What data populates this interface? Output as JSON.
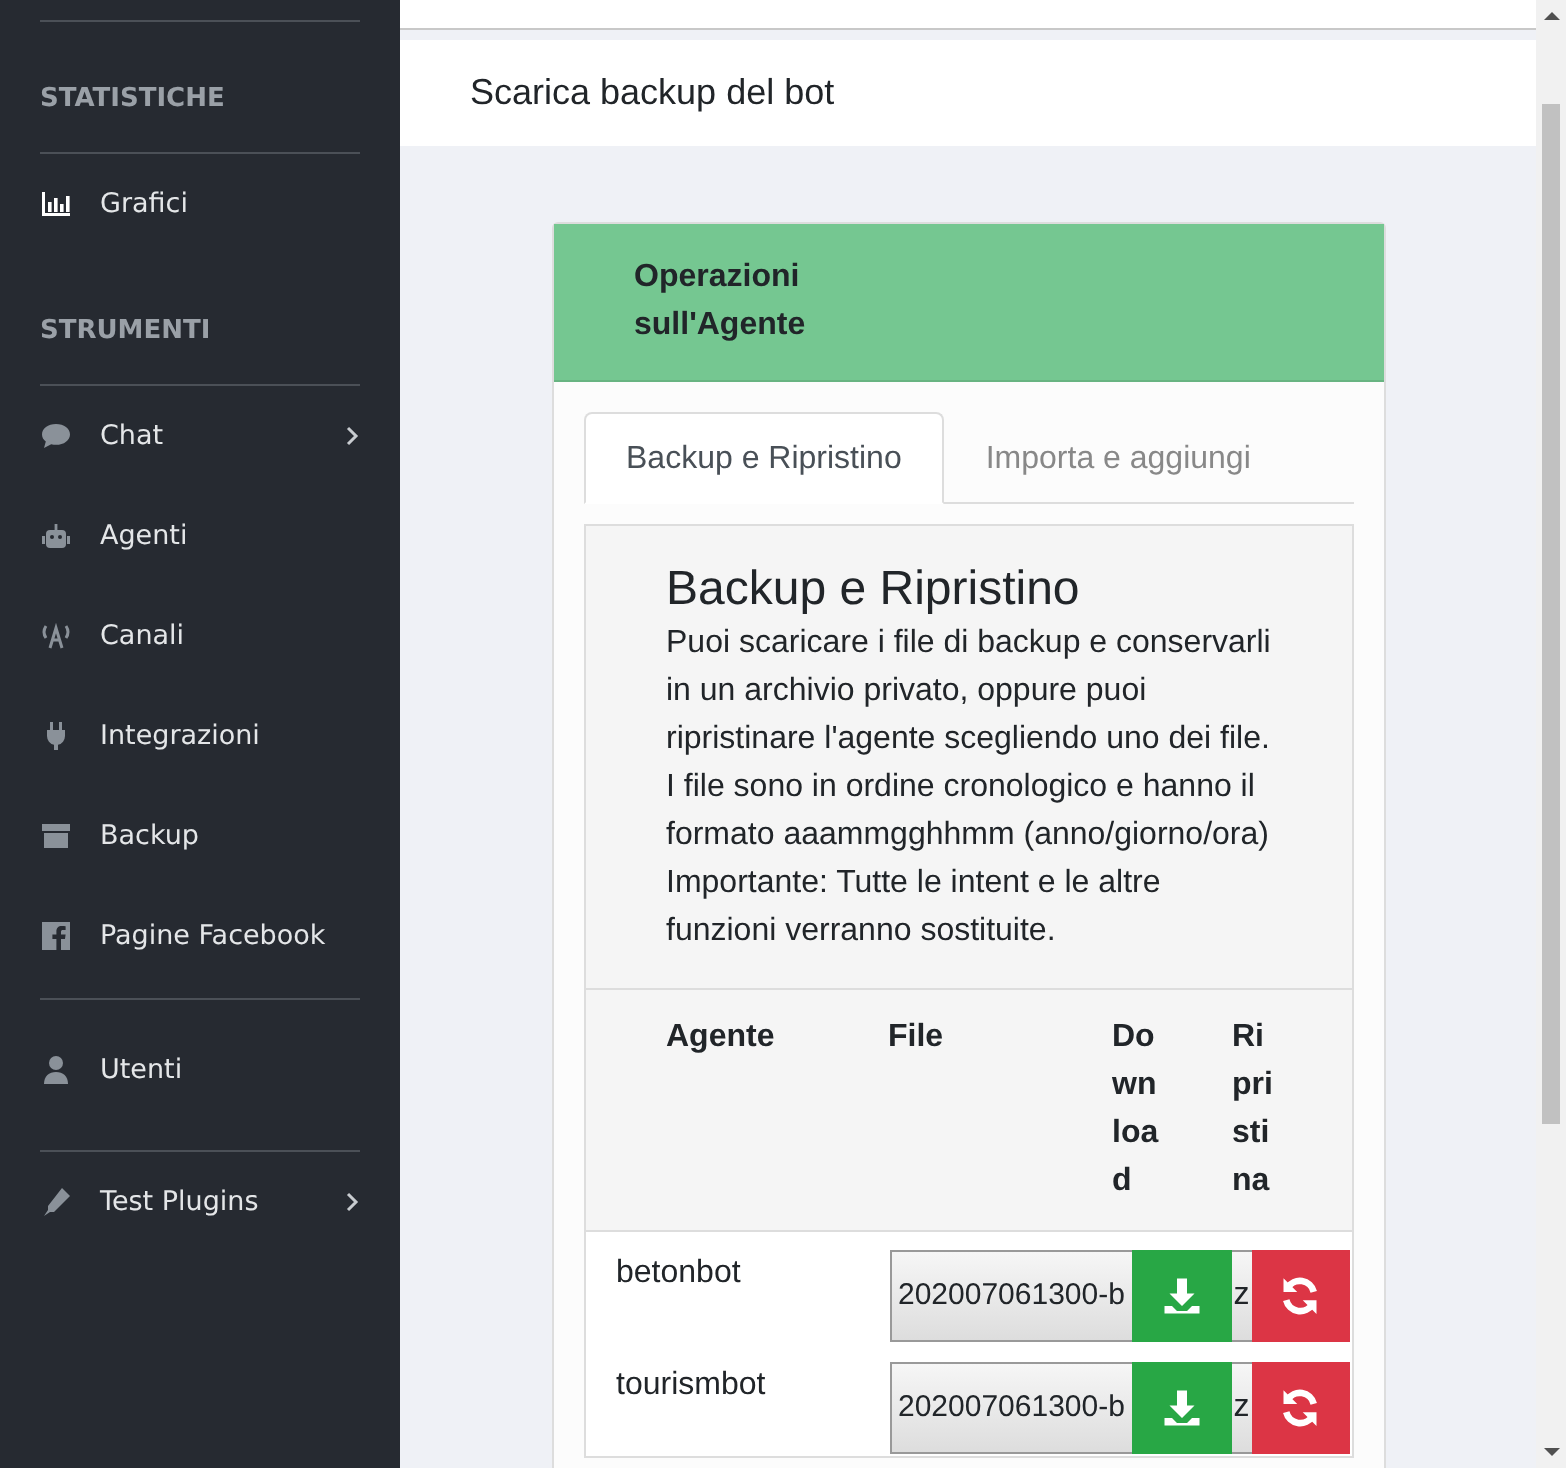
{
  "sidebar": {
    "sections": [
      {
        "heading": "STATISTICHE",
        "items": [
          {
            "label": "Grafici",
            "has_submenu": false
          }
        ]
      },
      {
        "heading": "STRUMENTI",
        "items": [
          {
            "label": "Chat",
            "has_submenu": true
          },
          {
            "label": "Agenti",
            "has_submenu": false
          },
          {
            "label": "Canali",
            "has_submenu": false
          },
          {
            "label": "Integrazioni",
            "has_submenu": false
          },
          {
            "label": "Backup",
            "has_submenu": false
          },
          {
            "label": "Pagine Facebook",
            "has_submenu": false
          }
        ]
      },
      {
        "items": [
          {
            "label": "Utenti",
            "has_submenu": false
          }
        ]
      },
      {
        "items": [
          {
            "label": "Test Plugins",
            "has_submenu": true
          }
        ]
      }
    ]
  },
  "page_title": "Scarica backup del bot",
  "card": {
    "header": "Operazioni sull'Agente",
    "tabs": [
      {
        "label": "Backup e Ripristino",
        "selected": true
      },
      {
        "label": "Importa e aggiungi",
        "selected": false
      }
    ],
    "panel": {
      "title": "Backup e Ripristino",
      "description": "Puoi scaricare i file di backup e conservarli in un archivio privato, oppure puoi ripristinare l'agente scegliendo uno dei file. I file sono in ordine cronologico e hanno il formato aaammgghhmm (anno/giorno/ora) Importante: Tutte le intent e le altre funzioni verranno sostituite."
    },
    "table": {
      "columns": [
        "Agente",
        "File",
        "Download",
        "Ripristina"
      ],
      "rows": [
        {
          "agent": "betonbot",
          "file": "202007061300-b",
          "file_tail": "z"
        },
        {
          "agent": "tourismbot",
          "file": "202007061300-b",
          "file_tail": "z"
        }
      ]
    }
  }
}
